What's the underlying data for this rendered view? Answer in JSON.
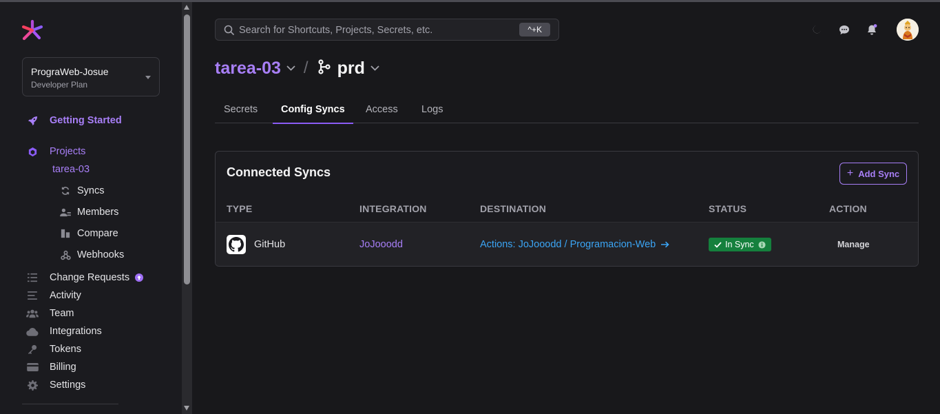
{
  "colors": {
    "accent": "#a87ff7",
    "status_ok": "#15803d",
    "link": "#3ba5f5"
  },
  "org": {
    "name": "PrograWeb-Josue",
    "plan": "Developer Plan"
  },
  "sidebar": {
    "getting_started": "Getting Started",
    "projects": "Projects",
    "current_project": "tarea-03",
    "project_items": [
      {
        "label": "Syncs",
        "icon": "sync-icon"
      },
      {
        "label": "Members",
        "icon": "members-icon"
      },
      {
        "label": "Compare",
        "icon": "compare-icon"
      },
      {
        "label": "Webhooks",
        "icon": "webhooks-icon"
      }
    ],
    "items": [
      {
        "label": "Change Requests",
        "icon": "change-requests-icon"
      },
      {
        "label": "Activity",
        "icon": "activity-icon"
      },
      {
        "label": "Team",
        "icon": "team-icon"
      },
      {
        "label": "Integrations",
        "icon": "cloud-icon"
      },
      {
        "label": "Tokens",
        "icon": "key-icon"
      },
      {
        "label": "Billing",
        "icon": "credit-card-icon"
      },
      {
        "label": "Settings",
        "icon": "gear-icon"
      }
    ]
  },
  "search": {
    "placeholder": "Search for Shortcuts, Projects, Secrets, etc.",
    "shortcut": "^+K"
  },
  "breadcrumb": {
    "project": "tarea-03",
    "separator": "/",
    "environment": "prd"
  },
  "tabs": [
    "Secrets",
    "Config Syncs",
    "Access",
    "Logs"
  ],
  "active_tab": "Config Syncs",
  "panel": {
    "title": "Connected Syncs",
    "add_button": "Add Sync",
    "columns": [
      "TYPE",
      "INTEGRATION",
      "DESTINATION",
      "STATUS",
      "ACTION"
    ],
    "rows": [
      {
        "type": "GitHub",
        "integration": "JoJooodd",
        "destination": "Actions: JoJooodd / Programacion-Web",
        "status": "In Sync",
        "action": "Manage"
      }
    ]
  }
}
